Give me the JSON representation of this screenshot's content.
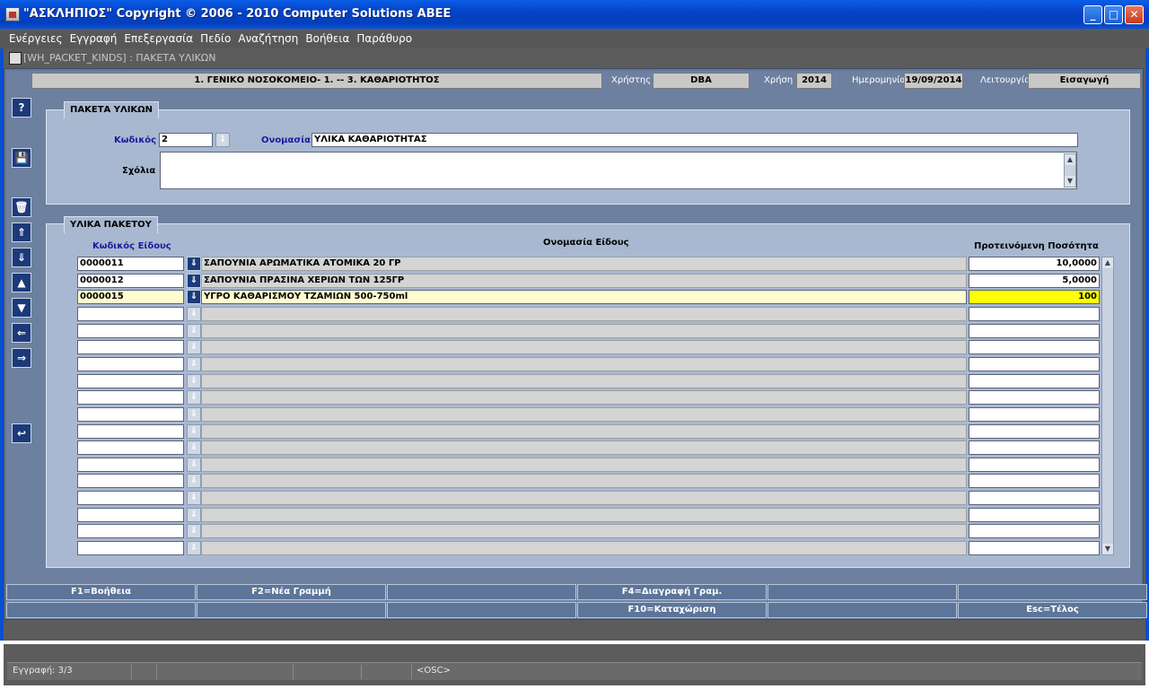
{
  "window": {
    "title": "\"ΑΣΚΛΗΠΙΟΣ\" Copyright © 2006 - 2010 Computer Solutions ABEE",
    "minimize": "_",
    "maximize": "□",
    "close": "✕"
  },
  "menu": [
    "Ενέργειες",
    "Εγγραφή",
    "Επεξεργασία",
    "Πεδίο",
    "Αναζήτηση",
    "Βοήθεια",
    "Παράθυρο"
  ],
  "doc_title": "[WH_PACKET_KINDS]  :  ΠΑΚΕΤΑ ΥΛΙΚΩΝ",
  "header": {
    "hospital": "1. ΓΕΝΙΚΟ ΝΟΣΟΚΟΜΕΙΟ- 1. -- 3. ΚΑΘΑΡΙΟΤΗΤΟΣ",
    "user_label": "Χρήστης",
    "user": "DBA",
    "year_label": "Χρήση",
    "year": "2014",
    "date_label": "Ημερομηνία",
    "date": "19/09/2014",
    "mode_label": "Λειτουργία",
    "mode": "Εισαγωγή"
  },
  "toolbar": {
    "help": "?",
    "save": "💾",
    "delete": "🗑",
    "first": "⇑",
    "last": "⇓",
    "prev": "▲",
    "next": "▼",
    "left": "⇐",
    "right": "⇒",
    "undo": "↩"
  },
  "packet": {
    "panel_title": "ΠΑΚΕΤΑ ΥΛΙΚΩΝ",
    "code_label": "Κωδικός",
    "code": "2",
    "name_label": "Ονομασία",
    "name": "ΥΛΙΚΑ ΚΑΘΑΡΙΟΤΗΤΑΣ",
    "comments_label": "Σχόλια",
    "comments": ""
  },
  "items": {
    "panel_title": "ΥΛΙΚΑ ΠΑΚΕΤΟΥ",
    "col_code": "Κωδικός Είδους",
    "col_name": "Ονομασία Είδους",
    "col_qty": "Προτεινόμενη Ποσότητα",
    "rows": [
      {
        "code": "0000011",
        "name": "ΣΑΠΟΥΝΙΑ ΑΡΩΜΑΤΙΚΑ ΑΤΟΜΙΚΑ 20 ΓΡ",
        "qty": "10,0000"
      },
      {
        "code": "0000012",
        "name": "ΣΑΠΟΥΝΙΑ ΠΡΑΣΙΝΑ ΧΕΡΙΩΝ  ΤΩΝ 125ΓΡ",
        "qty": "5,0000"
      },
      {
        "code": "0000015",
        "name": "ΥΓΡΟ   ΚΑΘΑΡΙΣΜΟΥ ΤΖΑΜΙΩΝ 500-750ml",
        "qty": "100"
      }
    ]
  },
  "fkeys_row1": [
    "F1=Βοήθεια",
    "F2=Νέα Γραμμή",
    "",
    "F4=Διαγραφή Γραμ.",
    "",
    ""
  ],
  "fkeys_row2": [
    "",
    "",
    "",
    "F10=Καταχώριση",
    "",
    "Esc=Τέλος"
  ],
  "status": {
    "record": "Εγγραφή: 3/3",
    "osc": "<OSC>"
  },
  "colors": {
    "title_blue": "#0542c6",
    "panel": "#a8b8d0",
    "highlight": "#ffff00",
    "label_blue": "#1a1aa0"
  }
}
